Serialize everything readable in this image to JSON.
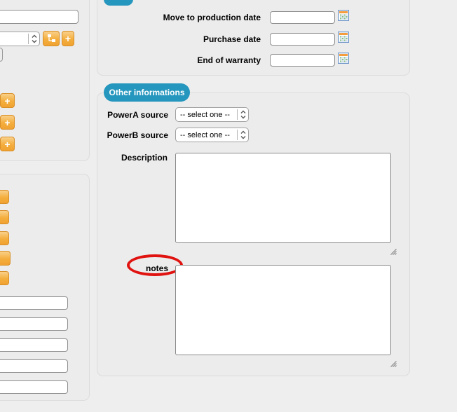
{
  "colors": {
    "section_tab_blue": "#2596be",
    "action_button_orange": "#f0a231",
    "annotation_red": "#e01310",
    "panel_background": "#ececec",
    "page_background": "#eeeeee"
  },
  "sidebar_top": {
    "search_value": "",
    "select_value": "",
    "add_button_label": "+",
    "plus_buttons": [
      "+",
      "+",
      "+"
    ]
  },
  "sidebar_bottom": {
    "input_values": [
      "",
      "",
      "",
      "",
      ""
    ]
  },
  "dates_section": {
    "rows": [
      {
        "label": "Move to production date",
        "value": ""
      },
      {
        "label": "Purchase date",
        "value": ""
      },
      {
        "label": "End of warranty",
        "value": ""
      }
    ]
  },
  "other_section": {
    "tab_label": "Other informations",
    "power_rows": [
      {
        "label": "PowerA source",
        "selected": "-- select one --"
      },
      {
        "label": "PowerB source",
        "selected": "-- select one --"
      }
    ],
    "description_label": "Description",
    "description_value": "",
    "notes_label": "notes",
    "notes_value": ""
  }
}
